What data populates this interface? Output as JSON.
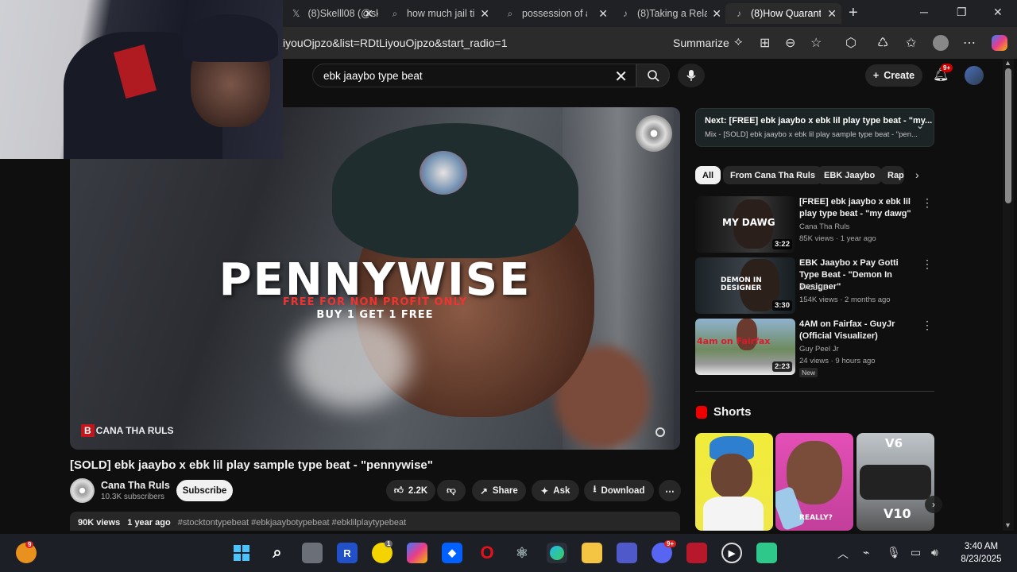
{
  "browser": {
    "tabs": [
      {
        "label": "(8)Skelll08 (@sk",
        "icon": "x-icon"
      },
      {
        "label": "how much jail ti",
        "icon": "search-icon"
      },
      {
        "label": "possession of a",
        "icon": "search-icon"
      },
      {
        "label": "(8)Taking a Rela",
        "icon": "tiktok-icon"
      },
      {
        "label": "(8)How Quarant",
        "icon": "tiktok-icon"
      }
    ],
    "url": "iyouOjpzo&list=RDtLiyouOjpzo&start_radio=1",
    "summarize_label": "Summarize"
  },
  "youtube": {
    "search_query": "ebk jaaybo type beat",
    "create_label": "Create",
    "notif_count": "9+",
    "video": {
      "overlay_title": "PENNYWISE",
      "overlay_line1": "FREE FOR NON PROFIT ONLY",
      "overlay_line2": "BUY 1 GET 1 FREE",
      "watermark": "CANA THA RULS",
      "watermark_initial": "B",
      "title": "[SOLD] ebk jaaybo x ebk lil play sample type beat - \"pennywise\"",
      "channel": "Cana Tha Ruls",
      "subscribers": "10.3K subscribers",
      "subscribe_label": "Subscribe",
      "likes": "2.2K",
      "share_label": "Share",
      "ask_label": "Ask",
      "download_label": "Download",
      "views": "90K views",
      "age": "1 year ago",
      "tags": "#stocktontypebeat #ebkjaaybotypebeat #ebklilplaytypebeat"
    },
    "up_next": {
      "line1": "Next: [FREE] ebk jaaybo x ebk lil play type beat - \"my...",
      "line2": "Mix - [SOLD] ebk jaaybo x ebk lil play sample type beat - \"pen..."
    },
    "chips": [
      "All",
      "From Cana Tha Ruls",
      "EBK Jaaybo",
      "Rap"
    ],
    "recommendations": [
      {
        "title": "[FREE] ebk jaaybo x ebk lil play type beat - \"my dawg\"",
        "channel": "Cana Tha Ruls",
        "meta": "85K views · 1 year ago",
        "duration": "3:22",
        "thumb_text": "MY DAWG",
        "badge": ""
      },
      {
        "title": "EBK Jaaybo x Pay Gotti Type Beat - \"Demon In Designer\"",
        "channel": "27CLUB",
        "meta": "154K views · 2 months ago",
        "duration": "3:30",
        "thumb_text": "DEMON IN DESIGNER",
        "badge": ""
      },
      {
        "title": "4AM on Fairfax - GuyJr (Official Visualizer)",
        "channel": "Guy Peel Jr",
        "meta": "24 views · 9 hours ago",
        "duration": "2:23",
        "thumb_text": "4am on Fairfax",
        "badge": "New"
      }
    ],
    "shorts_label": "Shorts",
    "shorts": [
      {
        "caption": ""
      },
      {
        "caption": "REALLY?"
      },
      {
        "caption": "V10",
        "top_caption": "V6"
      }
    ]
  },
  "taskbar": {
    "time": "3:40 AM",
    "date": "8/23/2025",
    "badges": {
      "left_app": "9",
      "notif": "1",
      "discord": "9+"
    }
  }
}
